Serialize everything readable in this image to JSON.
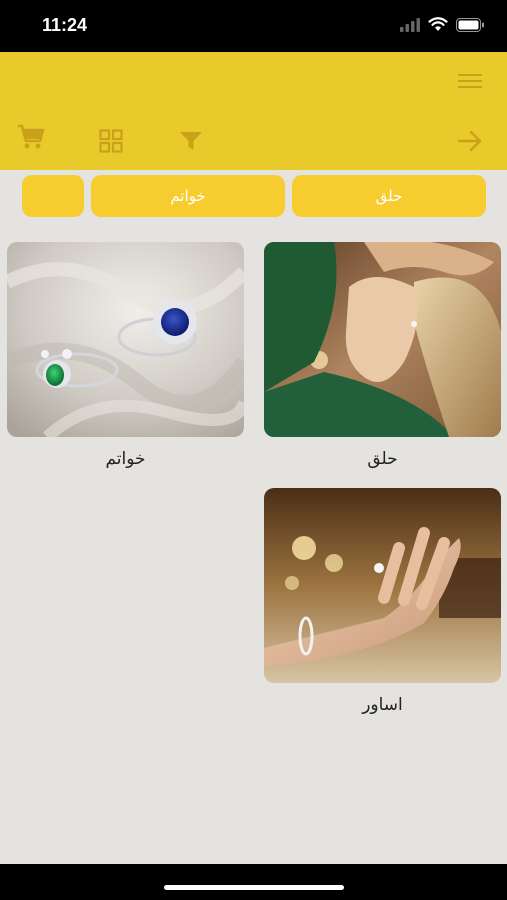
{
  "status_bar": {
    "time": "11:24"
  },
  "header": {
    "icons": [
      "menu-icon",
      "cart-icon",
      "grid-view-icon",
      "filter-icon",
      "arrow-right-icon"
    ],
    "background_color": "#e8cb2a",
    "icon_color": "#c9a21a"
  },
  "categories": [
    {
      "label": "حلق"
    },
    {
      "label": "خواتم"
    },
    {
      "label": ""
    }
  ],
  "products": [
    {
      "label": "خواتم",
      "image": "rings-photo"
    },
    {
      "label": "حلق",
      "image": "earrings-photo"
    },
    {
      "label": "اساور",
      "image": "bracelet-ring-photo"
    }
  ],
  "colors": {
    "pill": "#f6cc2f",
    "background": "#e5e3df"
  }
}
